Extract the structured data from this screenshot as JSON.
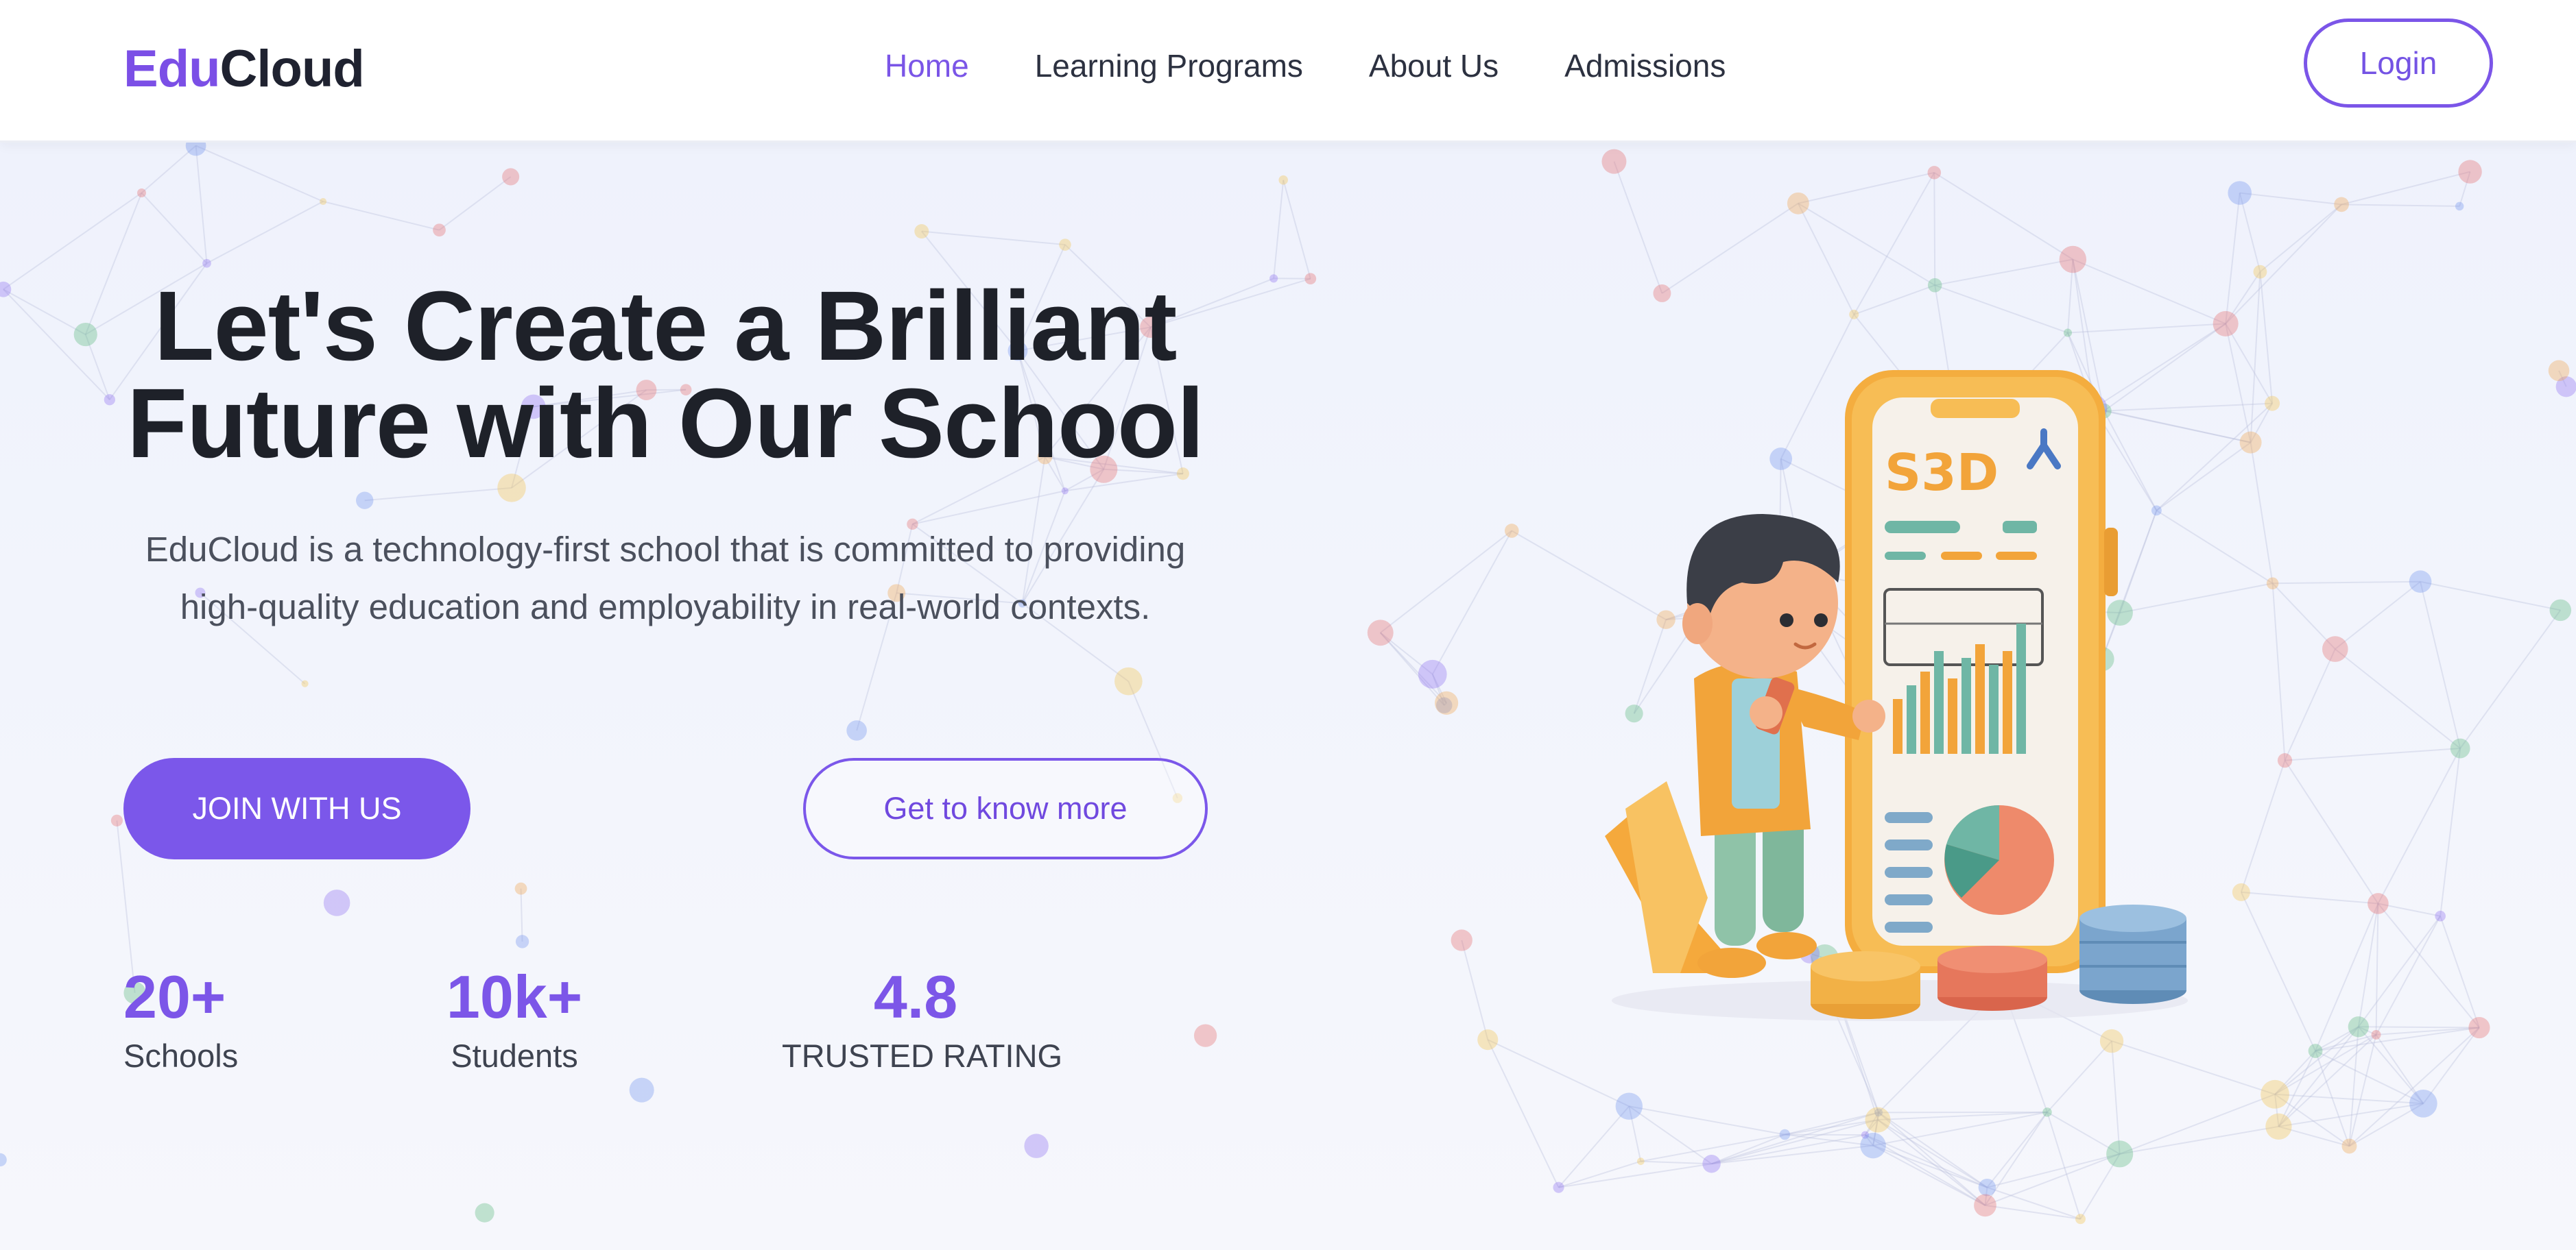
{
  "header": {
    "logo_part1": "Edu",
    "logo_part2": "Cloud",
    "nav": [
      {
        "label": "Home",
        "active": true
      },
      {
        "label": "Learning Programs",
        "active": false
      },
      {
        "label": "About Us",
        "active": false
      },
      {
        "label": "Admissions",
        "active": false
      }
    ],
    "login_label": "Login"
  },
  "hero": {
    "title_line1": "Let's Create a Brilliant",
    "title_line2": "Future with Our School",
    "description": "EduCloud is a technology-first school that is committed to providing high-quality education and employability in real-world contexts.",
    "primary_button": "JOIN WITH US",
    "secondary_button": "Get to know more",
    "stats": [
      {
        "value": "20+",
        "label": "Schools"
      },
      {
        "value": "10k+",
        "label": "Students"
      },
      {
        "value": "4.8",
        "label": "TRUSTED RATING"
      }
    ]
  },
  "illustration": {
    "phone_text": "S3D",
    "icon": "student-with-phone-chart-illustration"
  },
  "colors": {
    "brand": "#7b57ea",
    "text_dark": "#1e2129",
    "background": "#f3f5fc"
  }
}
